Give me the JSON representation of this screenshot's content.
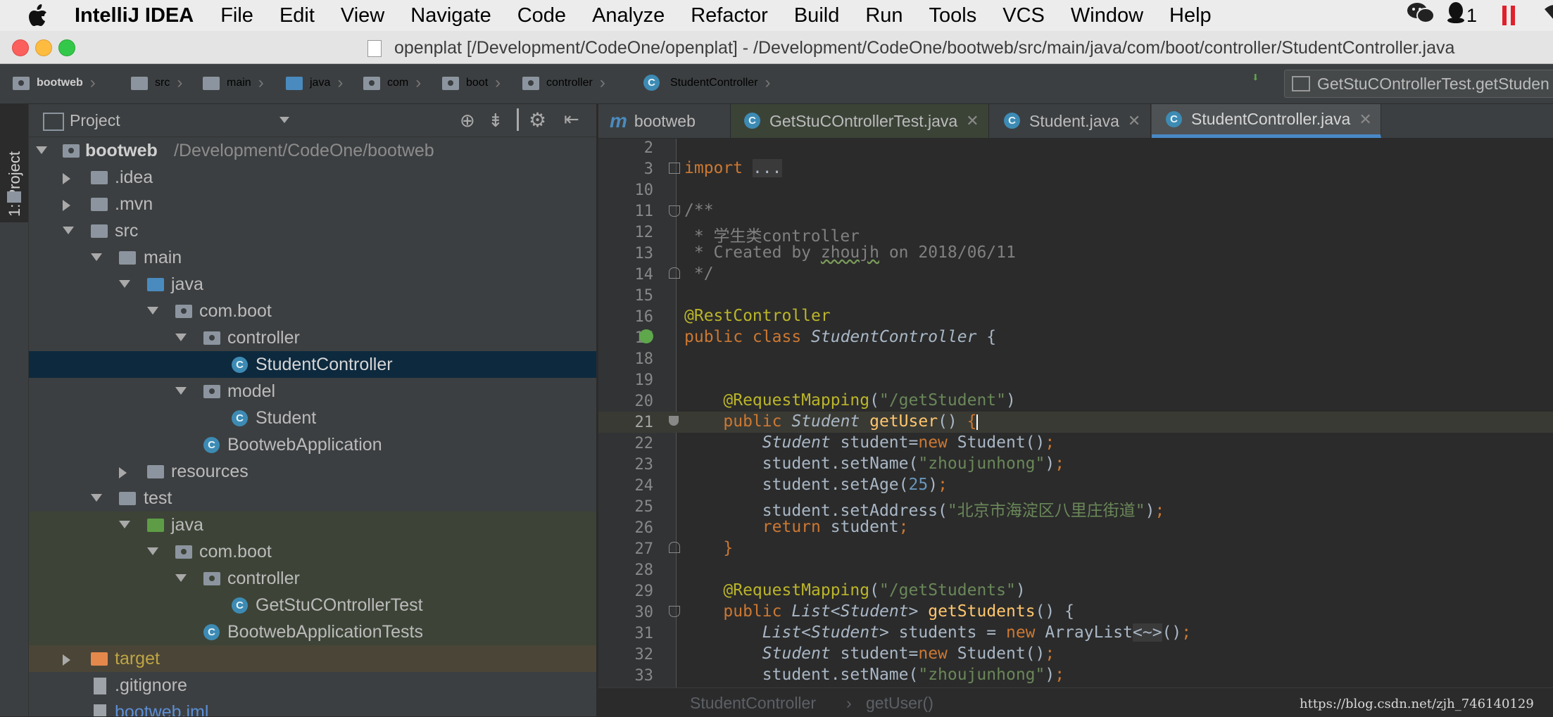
{
  "menubar": {
    "app_name": "IntelliJ IDEA",
    "items": [
      "File",
      "Edit",
      "View",
      "Navigate",
      "Code",
      "Analyze",
      "Refactor",
      "Build",
      "Run",
      "Tools",
      "VCS",
      "Window",
      "Help"
    ],
    "qq_count": "1"
  },
  "window": {
    "title": "openplat [/Development/CodeOne/openplat] - /Development/CodeOne/bootweb/src/main/java/com/boot/controller/StudentController.java"
  },
  "navbar": {
    "crumbs": [
      "bootweb",
      "src",
      "main",
      "java",
      "com",
      "boot",
      "controller",
      "StudentController"
    ],
    "run_config": "GetStuCOntrollerTest.getStuden"
  },
  "project_panel": {
    "title": "Project",
    "tool_tab": "1: Project",
    "tree": [
      {
        "name": "bootweb",
        "path": "/Development/CodeOne/bootweb"
      },
      {
        "name": ".idea"
      },
      {
        "name": ".mvn"
      },
      {
        "name": "src"
      },
      {
        "name": "main"
      },
      {
        "name": "java"
      },
      {
        "name": "com.boot"
      },
      {
        "name": "controller"
      },
      {
        "name": "StudentController"
      },
      {
        "name": "model"
      },
      {
        "name": "Student"
      },
      {
        "name": "BootwebApplication"
      },
      {
        "name": "resources"
      },
      {
        "name": "test"
      },
      {
        "name": "java"
      },
      {
        "name": "com.boot"
      },
      {
        "name": "controller"
      },
      {
        "name": "GetStuCOntrollerTest"
      },
      {
        "name": "BootwebApplicationTests"
      },
      {
        "name": "target"
      },
      {
        "name": ".gitignore"
      },
      {
        "name": "bootweb.iml"
      }
    ]
  },
  "tabs": [
    {
      "label": "bootweb"
    },
    {
      "label": "GetStuCOntrollerTest.java"
    },
    {
      "label": "Student.java"
    },
    {
      "label": "StudentController.java"
    }
  ],
  "editor": {
    "line_numbers": [
      "2",
      "3",
      "10",
      "11",
      "12",
      "13",
      "14",
      "15",
      "16",
      "17",
      "18",
      "19",
      "20",
      "21",
      "22",
      "23",
      "24",
      "25",
      "26",
      "27",
      "28",
      "29",
      "30",
      "31",
      "32",
      "33"
    ],
    "comment_body": "学生类controller",
    "created_by": "Created by ",
    "author": "zhoujh",
    "created_on": " on 2018/06/11",
    "map_get_student": "\"/getStudent\"",
    "map_get_students": "\"/getStudents\"",
    "name_value": "\"zhoujunhong\"",
    "age_value": "25",
    "address_value": "\"北京市海淀区八里庄街道\""
  },
  "footer": {
    "crumb_class": "StudentController",
    "crumb_method": "getUser()",
    "watermark": "https://blog.csdn.net/zjh_746140129"
  },
  "colors": {
    "keyword": "#cc7832",
    "annotation": "#bbb529",
    "string": "#6a8759",
    "number": "#6897bb",
    "comment": "#808080",
    "selection": "#0d293e"
  }
}
